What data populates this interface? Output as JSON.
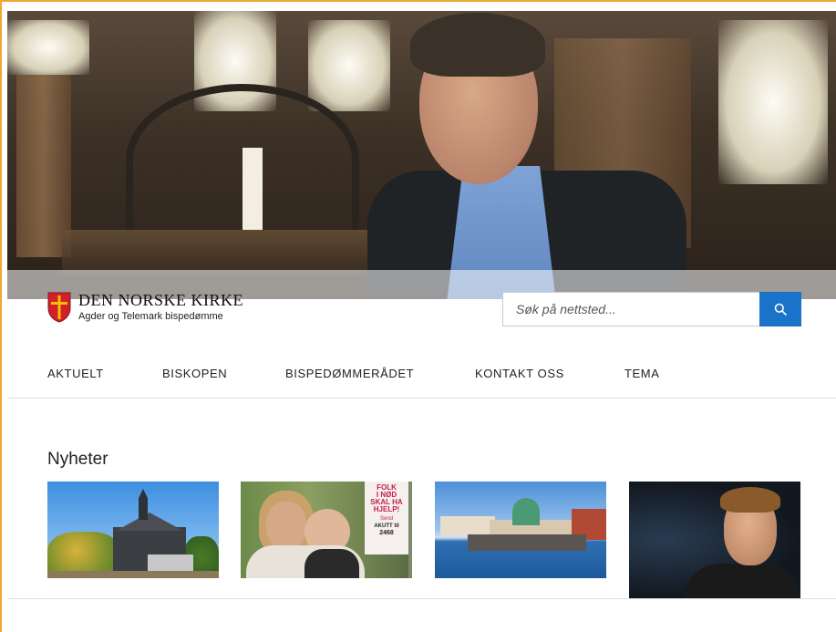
{
  "site": {
    "logo_title": "DEN NORSKE KIRKE",
    "logo_subtitle": "Agder og Telemark bispedømme"
  },
  "search": {
    "placeholder": "Søk på nettsted...",
    "button_icon": "search-icon"
  },
  "nav": {
    "items": [
      {
        "label": "AKTUELT"
      },
      {
        "label": "BISKOPEN"
      },
      {
        "label": "BISPEDØMMERÅDET"
      },
      {
        "label": "KONTAKT OSS"
      },
      {
        "label": "TEMA"
      }
    ]
  },
  "news": {
    "heading": "Nyheter",
    "poster_text": {
      "line1": "FOLK",
      "line2": "I NØD",
      "line3": "SKAL HA",
      "line4": "HJELP!",
      "line5": "Send",
      "line6": "AKUTT til",
      "line7": "2468"
    }
  },
  "colors": {
    "accent": "#1a73c8",
    "frame": "#f0a830",
    "shield_red": "#d4202a"
  }
}
